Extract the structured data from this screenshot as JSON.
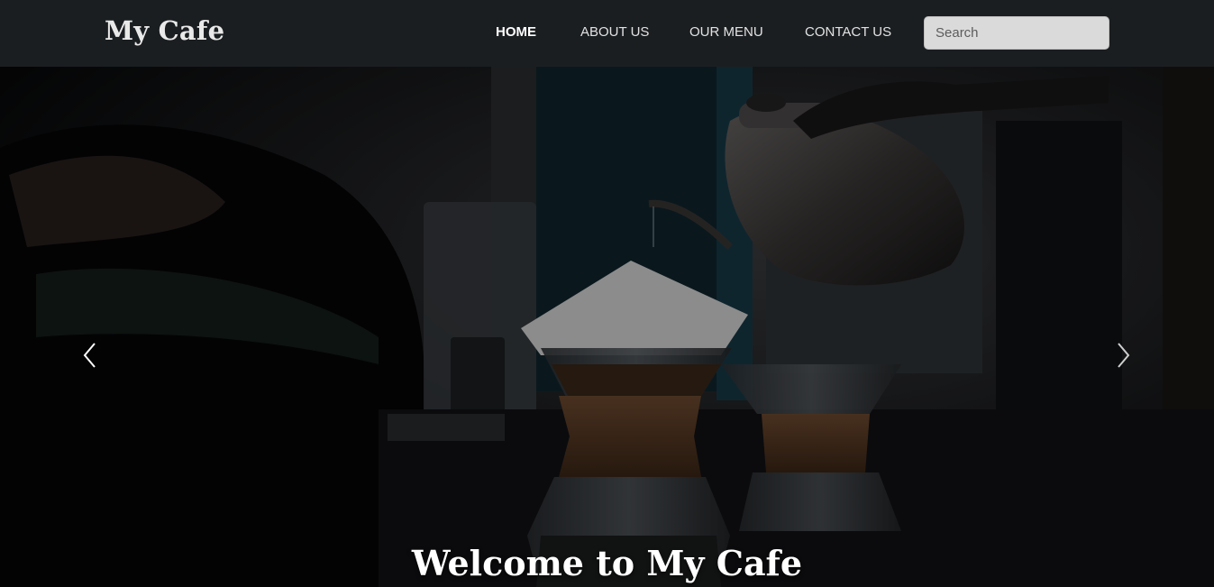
{
  "navbar": {
    "brand": "My Cafe",
    "links": [
      {
        "label": "HOME",
        "active": true
      },
      {
        "label": "ABOUT US",
        "active": false
      },
      {
        "label": "OUR MENU",
        "active": false
      },
      {
        "label": "CONTACT US",
        "active": false
      }
    ],
    "search": {
      "placeholder": "Search",
      "value": ""
    }
  },
  "hero": {
    "caption": "Welcome to My Cafe",
    "prev_icon": "chevron-left-icon",
    "next_icon": "chevron-right-icon"
  },
  "colors": {
    "navbar_bg": "#1b1e21",
    "brand_text": "#e9e9e9",
    "nav_text": "#e2e2e2",
    "search_bg": "#dadada",
    "hero_overlay": "#090a0c"
  }
}
